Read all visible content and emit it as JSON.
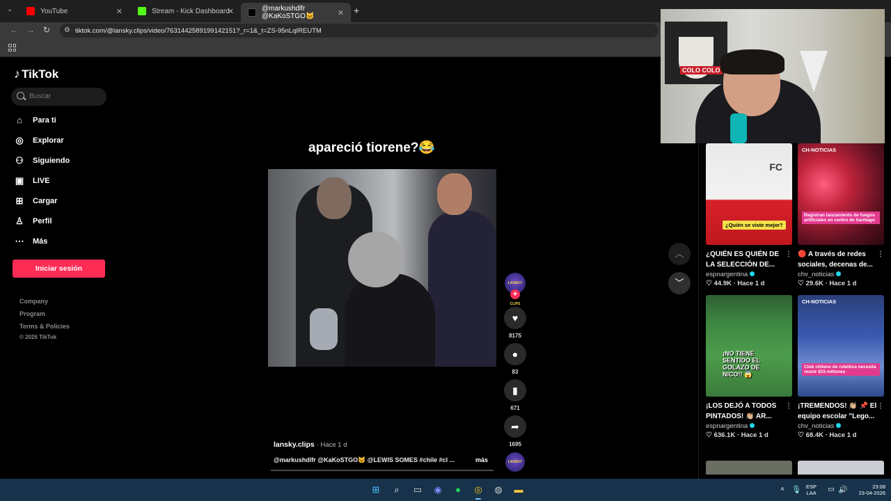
{
  "browser": {
    "tabs": [
      {
        "title": "YouTube",
        "active": false
      },
      {
        "title": "Stream - Kick Dashboard",
        "active": false
      },
      {
        "title": "@markushdlfr @KaKoSTGO🐱",
        "active": true
      }
    ],
    "new_tab": "+",
    "url": "tiktok.com/@lansky.clips/video/763144258919914215​1?_r=1&_t=ZS-95nLqIREUTM"
  },
  "tiktok": {
    "logo": "TikTok",
    "search_placeholder": "Buscar",
    "nav": [
      {
        "label": "Para ti",
        "icon": "home-icon"
      },
      {
        "label": "Explorar",
        "icon": "compass-icon"
      },
      {
        "label": "Siguiendo",
        "icon": "user-follow-icon"
      },
      {
        "label": "LIVE",
        "icon": "live-icon"
      },
      {
        "label": "Cargar",
        "icon": "upload-icon"
      },
      {
        "label": "Perfil",
        "icon": "profile-icon"
      },
      {
        "label": "Más",
        "icon": "more-icon"
      }
    ],
    "login_button": "Iniciar sesión",
    "footer": [
      "Company",
      "Program",
      "Terms & Policies",
      "© 2026 TikTok"
    ]
  },
  "video": {
    "caption": "apareció tiorene?😂",
    "author": "lansky.clips",
    "time": "· Hace 1 d",
    "description": "@markushdlfr @KaKoSTGO🐱 @LEWIS SOMES  #chile #cl ...",
    "more": "más",
    "avatar_text": "LANSKY CLIPS",
    "progress": 0.0,
    "actions": [
      {
        "name": "like",
        "icon": "heart-icon",
        "count": "8175"
      },
      {
        "name": "comment",
        "icon": "comment-icon",
        "count": "83"
      },
      {
        "name": "save",
        "icon": "bookmark-icon",
        "count": "671"
      },
      {
        "name": "share",
        "icon": "share-icon",
        "count": "1695"
      }
    ]
  },
  "related": [
    {
      "title": "¿QUIÉN ES QUIÉN DE LA SELECCIÓN DE...",
      "author": "espnargentina",
      "likes": "44.9K",
      "time": "· Hace 1 d",
      "thumb_text": "¿Quién se viste mejor?",
      "thumb_badge": "FC"
    },
    {
      "title": "🔴 A través de redes sociales, decenas de...",
      "author": "chv_noticias",
      "likes": "29.6K",
      "time": "· Hace 1 d",
      "thumb_badge": "CH-NOTICIAS",
      "thumb_text": "Registran lanzamiento de fuegos artificiales en centro de Santiago"
    },
    {
      "title": "¡LOS DEJÓ A TODOS PINTADOS! 👏🏼 AR...",
      "author": "espnargentina",
      "likes": "636.1K",
      "time": "· Hace 1 d",
      "thumb_text": "¡NO TIENE SENTIDO EL GOLAZO DE NICO!! 😱"
    },
    {
      "title": "¡TREMENDOS! 👏🏼 📌 El equipo escolar \"Lego...",
      "author": "chv_noticias",
      "likes": "68.4K",
      "time": "· Hace 1 d",
      "thumb_badge": "CH-NOTICIAS",
      "thumb_text": "Club chileno de robótica necesita reunir $15 millones"
    }
  ],
  "webcam": {
    "flag_text": "COLO COLO"
  },
  "taskbar": {
    "lang": "ESP",
    "layout": "LAA",
    "time": "23:08",
    "date": "23-04-2026"
  }
}
